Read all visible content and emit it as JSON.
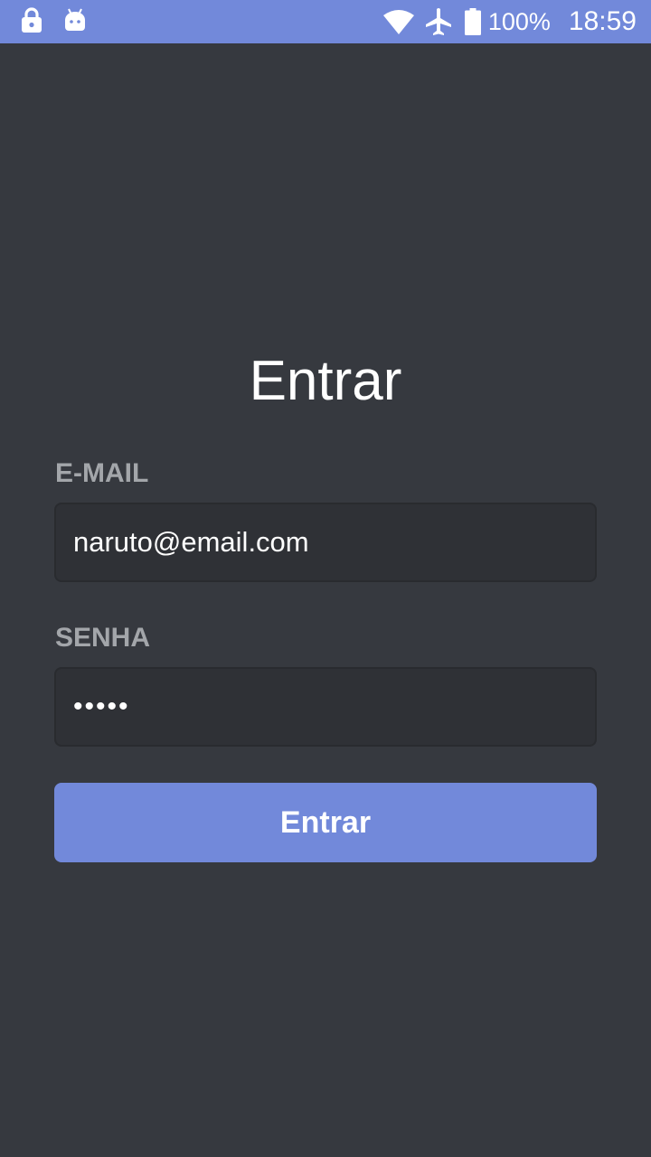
{
  "status_bar": {
    "icons_left": [
      "lock-icon",
      "android-debug-icon"
    ],
    "icons_right": [
      "wifi-icon",
      "airplane-icon",
      "battery-icon"
    ],
    "battery": "100%",
    "time": "18:59",
    "background_color": "#7289da"
  },
  "login": {
    "title": "Entrar",
    "email_label": "E-MAIL",
    "email_value": "naruto@email.com",
    "password_label": "SENHA",
    "password_value": "•••••",
    "submit_label": "Entrar"
  },
  "colors": {
    "background": "#36393f",
    "input_background": "#2f3136",
    "label": "#a3a6aa",
    "accent": "#7289da"
  }
}
